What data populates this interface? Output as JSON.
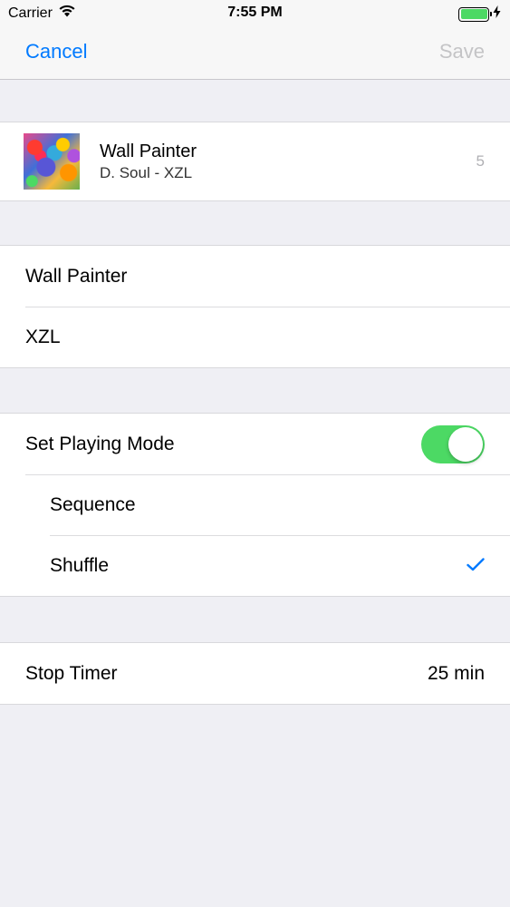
{
  "status_bar": {
    "carrier": "Carrier",
    "time": "7:55 PM",
    "battery_level": 1.0,
    "battery_color": "#4cd964"
  },
  "nav": {
    "cancel_label": "Cancel",
    "save_label": "Save",
    "accent_color": "#007aff"
  },
  "song": {
    "title": "Wall Painter",
    "subtitle": "D. Soul - XZL",
    "count": "5"
  },
  "fields": {
    "title_value": "Wall Painter",
    "artist_value": "XZL"
  },
  "playing_mode": {
    "label": "Set Playing Mode",
    "enabled": true,
    "options": [
      {
        "label": "Sequence",
        "selected": false
      },
      {
        "label": "Shuffle",
        "selected": true
      }
    ]
  },
  "timer": {
    "label": "Stop Timer",
    "value": "25 min"
  }
}
